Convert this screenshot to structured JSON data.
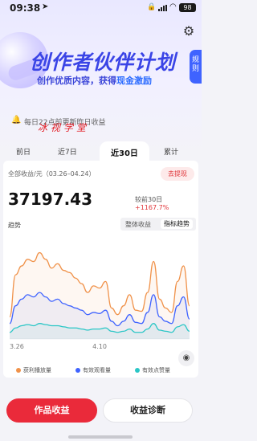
{
  "status_bar": {
    "time": "09:38",
    "battery": "98"
  },
  "header": {
    "title": "创作者伙伴计划",
    "subtitle_prefix": "创作优质内容，获得",
    "subtitle_highlight": "现金激励",
    "rules_tab": "规则"
  },
  "notice": {
    "text": "每日22点前更新昨日收益"
  },
  "signature": "冰视学堂",
  "tabs": [
    {
      "label": "前日",
      "active": false
    },
    {
      "label": "近7日",
      "active": false
    },
    {
      "label": "近30日",
      "active": true
    },
    {
      "label": "累计",
      "active": false
    }
  ],
  "summary": {
    "label": "全部收益/元（03.26–04.24）",
    "withdraw": "去提现",
    "total": "37197.43",
    "compare_prefix": "较前30日",
    "compare_value": "+1167.7%"
  },
  "trend": {
    "label": "趋势",
    "toggle": [
      "整体收益",
      "指标趋势"
    ],
    "selected": "指标趋势"
  },
  "chart_data": {
    "type": "line",
    "x_ticks": [
      "3.26",
      "4.10"
    ],
    "series": [
      {
        "name": "获利播放量",
        "color": "#f0924a",
        "values": [
          20,
          58,
          66,
          72,
          70,
          78,
          72,
          64,
          68,
          62,
          60,
          55,
          50,
          42,
          48,
          46,
          52,
          28,
          22,
          30,
          40,
          26,
          25,
          42,
          70,
          36,
          28,
          24,
          52,
          66,
          30
        ]
      },
      {
        "name": "有效观看量",
        "color": "#3f63ff",
        "values": [
          14,
          30,
          36,
          40,
          38,
          42,
          38,
          34,
          36,
          32,
          30,
          28,
          26,
          22,
          24,
          23,
          26,
          16,
          12,
          16,
          22,
          15,
          14,
          24,
          40,
          20,
          16,
          14,
          30,
          38,
          18
        ]
      },
      {
        "name": "有效点赞量",
        "color": "#2ac6c6",
        "values": [
          6,
          10,
          12,
          13,
          12,
          14,
          13,
          12,
          12,
          11,
          10,
          10,
          9,
          8,
          9,
          9,
          10,
          7,
          6,
          7,
          9,
          6,
          6,
          9,
          14,
          8,
          7,
          6,
          11,
          13,
          7
        ]
      }
    ],
    "ylim": [
      0,
      90
    ],
    "legend": "bottom"
  },
  "actions": {
    "primary": "作品收益",
    "secondary": "收益诊断"
  }
}
